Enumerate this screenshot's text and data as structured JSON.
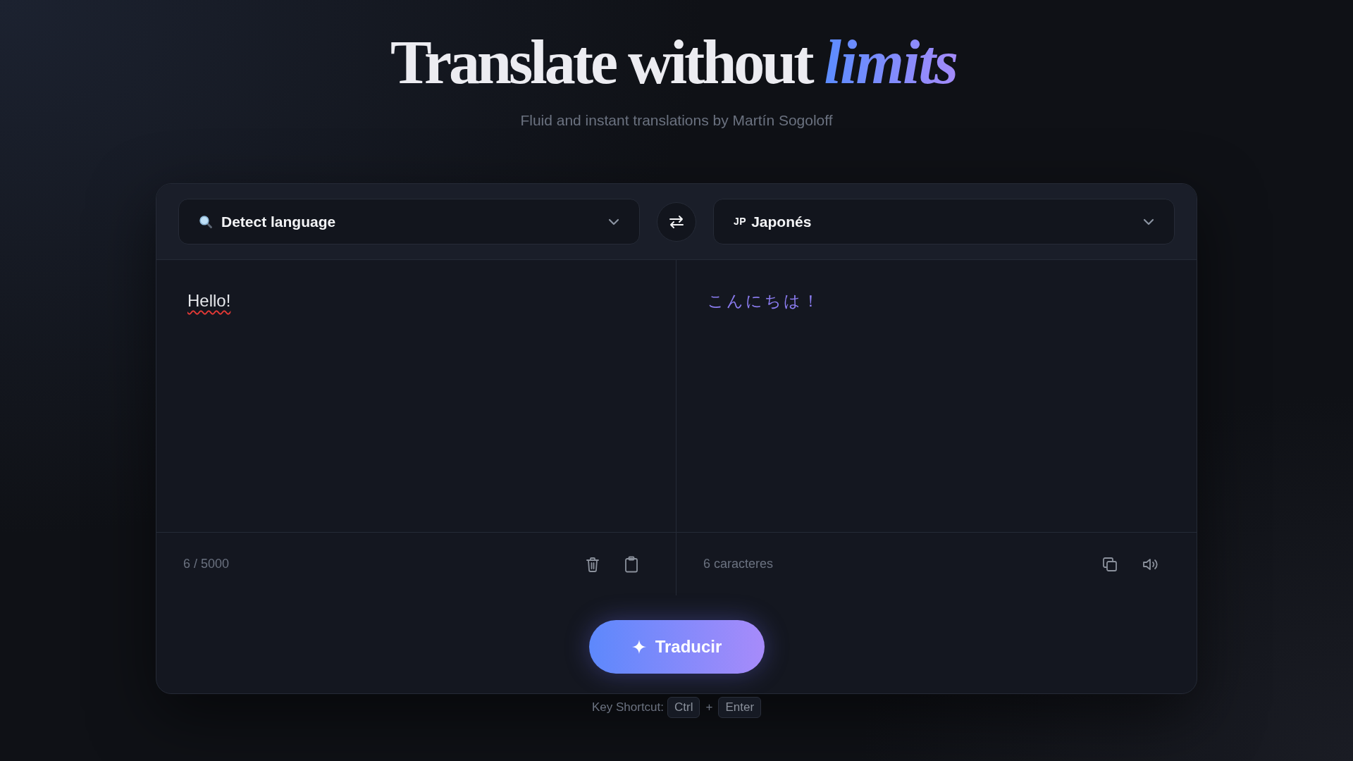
{
  "header": {
    "title": "Translate without *limits*",
    "subtitle": "Fluid and instant translations by Martín Sogoloff"
  },
  "language_bar": {
    "source": {
      "kind": "detect",
      "label": "Detect language"
    },
    "target": {
      "kind": "language",
      "code": "JP",
      "label": "Japonés"
    }
  },
  "panels": [
    {
      "kind": "source",
      "text": "Hello!",
      "misspelled": true,
      "counter": "6 / 5000"
    },
    {
      "kind": "target",
      "text": "こんにちは！",
      "counter": "6 caracteres"
    }
  ],
  "translate_button": {
    "label": "Traducir"
  },
  "shortcut": {
    "label": "Key Shortcut:",
    "keys": [
      "Ctrl",
      "Enter"
    ],
    "separator": "+"
  }
}
